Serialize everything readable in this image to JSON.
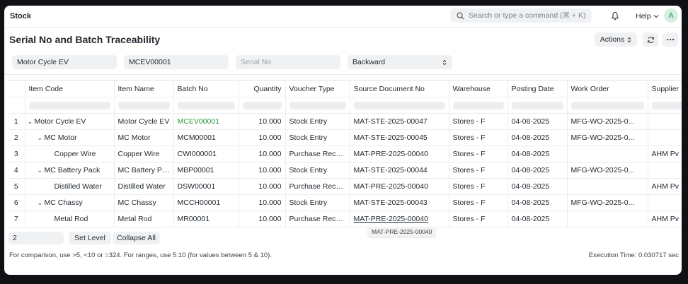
{
  "app": {
    "name": "Stock"
  },
  "search": {
    "placeholder": "Search or type a command (⌘ + K)"
  },
  "header": {
    "help_label": "Help",
    "avatar_initial": "A"
  },
  "page": {
    "title": "Serial No and Batch Traceability",
    "actions_label": "Actions"
  },
  "filters": {
    "item": "Motor Cycle EV",
    "batch": "MCEV00001",
    "serial_placeholder": "Serial No",
    "direction": "Backward"
  },
  "table": {
    "columns": [
      "Item Code",
      "Item Name",
      "Batch No",
      "Quantity",
      "Voucher Type",
      "Source Document No",
      "Warehouse",
      "Posting Date",
      "Work Order",
      "Supplier"
    ],
    "rows": [
      {
        "n": "1",
        "code": "Motor Cycle EV",
        "name": "Motor Cycle EV",
        "batch": "MCEV00001",
        "qty": "10.000",
        "vtype": "Stock Entry",
        "src": "MAT-STE-2025-00047",
        "wh": "Stores - F",
        "date": "04-08-2025",
        "wo": "MFG-WO-2025-0...",
        "sup": ""
      },
      {
        "n": "2",
        "code": "MC Motor",
        "name": "MC Motor",
        "batch": "MCM00001",
        "qty": "10.000",
        "vtype": "Stock Entry",
        "src": "MAT-STE-2025-00045",
        "wh": "Stores - F",
        "date": "04-08-2025",
        "wo": "MFG-WO-2025-0...",
        "sup": ""
      },
      {
        "n": "3",
        "code": "Copper Wire",
        "name": "Copper Wire",
        "batch": "CWI000001",
        "qty": "10.000",
        "vtype": "Purchase Receipt",
        "src": "MAT-PRE-2025-00040",
        "wh": "Stores - F",
        "date": "04-08-2025",
        "wo": "",
        "sup": "AHM Pv"
      },
      {
        "n": "4",
        "code": "MC Battery Pack",
        "name": "MC Battery Pa...",
        "batch": "MBP00001",
        "qty": "10.000",
        "vtype": "Stock Entry",
        "src": "MAT-STE-2025-00044",
        "wh": "Stores - F",
        "date": "04-08-2025",
        "wo": "MFG-WO-2025-0...",
        "sup": ""
      },
      {
        "n": "5",
        "code": "Distilled Water",
        "name": "Distilled Water",
        "batch": "DSW00001",
        "qty": "10.000",
        "vtype": "Purchase Receipt",
        "src": "MAT-PRE-2025-00040",
        "wh": "Stores - F",
        "date": "04-08-2025",
        "wo": "",
        "sup": "AHM Pv"
      },
      {
        "n": "6",
        "code": "MC Chassy",
        "name": "MC Chassy",
        "batch": "MCCH00001",
        "qty": "10.000",
        "vtype": "Stock Entry",
        "src": "MAT-STE-2025-00043",
        "wh": "Stores - F",
        "date": "04-08-2025",
        "wo": "MFG-WO-2025-0...",
        "sup": ""
      },
      {
        "n": "7",
        "code": "Metal Rod",
        "name": "Metal Rod",
        "batch": "MR00001",
        "qty": "10.000",
        "vtype": "Purchase Receipt",
        "src": "MAT-PRE-2025-00040",
        "wh": "Stores - F",
        "date": "04-08-2025",
        "wo": "",
        "sup": "AHM Pv"
      }
    ]
  },
  "tooltip": {
    "text": "MAT-PRE-2025-00040"
  },
  "footer": {
    "level_value": "2",
    "set_level_label": "Set Level",
    "collapse_all_label": "Collapse All",
    "hint": "For comparison, use >5, <10 or =324. For ranges, use 5:10 (for values between 5 & 10).",
    "execution_time": "Execution Time: 0.030717 sec"
  }
}
